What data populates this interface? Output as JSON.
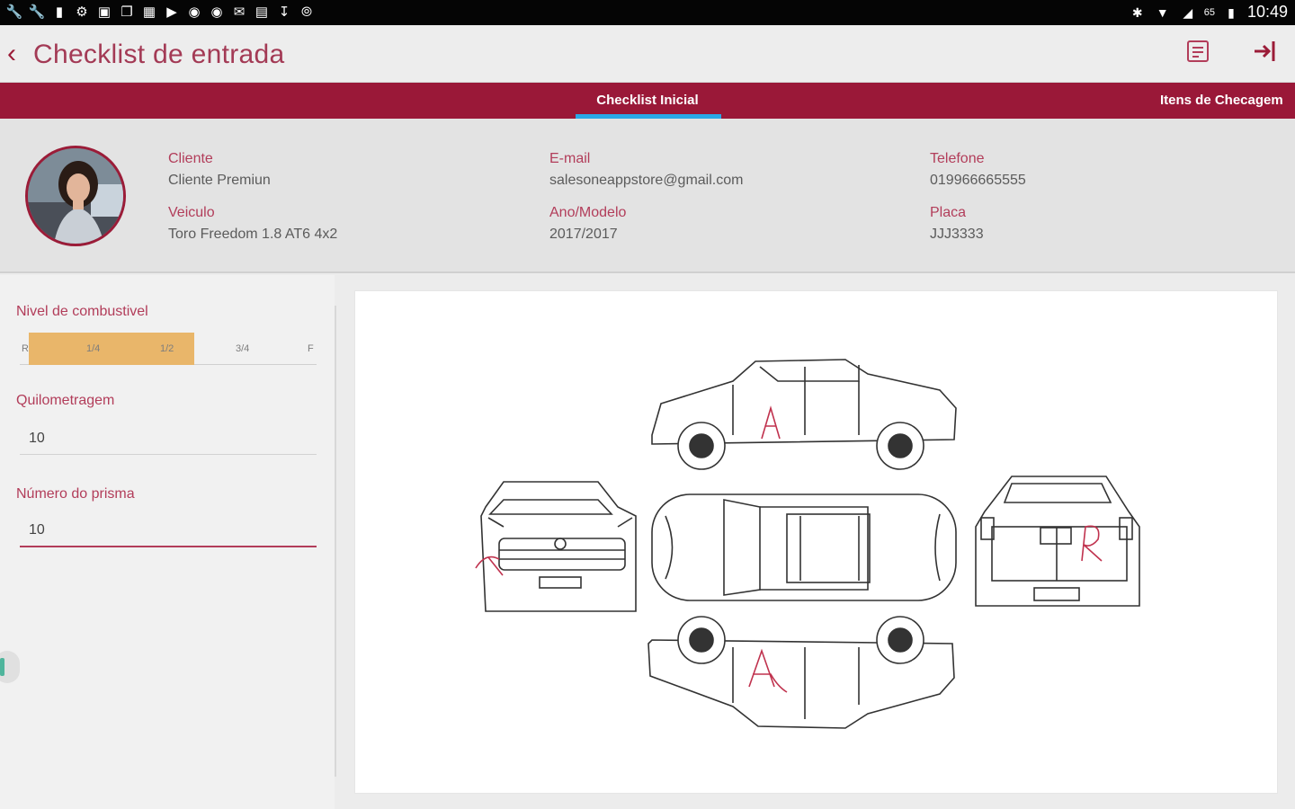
{
  "status_bar": {
    "left_icons": [
      "wrench-icon",
      "wrench-icon",
      "flashlight-icon",
      "settings-icon",
      "image-icon",
      "image-stack-icon",
      "calendar-icon",
      "youtube-icon",
      "app-icon",
      "app-icon",
      "mail-icon",
      "calendar-icon",
      "download-icon",
      "compass-icon"
    ],
    "battery": "65",
    "time": "10:49"
  },
  "app_bar": {
    "title": "Checklist de entrada",
    "actions": [
      "notes-icon",
      "exit-icon"
    ]
  },
  "tabs": [
    {
      "label": "Checklist Inicial",
      "active": true
    },
    {
      "label": "Itens de Checagem",
      "active": false
    }
  ],
  "client": {
    "fields": {
      "cliente_label": "Cliente",
      "cliente_value": "Cliente Premiun",
      "email_label": "E-mail",
      "email_value": "salesoneappstore@gmail.com",
      "telefone_label": "Telefone",
      "telefone_value": "019966665555",
      "veiculo_label": "Veiculo",
      "veiculo_value": "Toro Freedom 1.8 AT6 4x2",
      "ano_label": "Ano/Modelo",
      "ano_value": "2017/2017",
      "placa_label": "Placa",
      "placa_value": "JJJ3333"
    }
  },
  "form": {
    "fuel_label": "Nivel de combustivel",
    "fuel_ticks": [
      "R",
      "1/4",
      "1/2",
      "3/4",
      "F"
    ],
    "fuel_level": "1/2",
    "km_label": "Quilometragem",
    "km_value": "10",
    "prisma_label": "Número do prisma",
    "prisma_value": "10"
  },
  "colors": {
    "brand": "#9a1838",
    "accent_label": "#b23d5a",
    "tab_indicator": "#2aa8e6",
    "fuel_fill": "#e9b66a"
  }
}
